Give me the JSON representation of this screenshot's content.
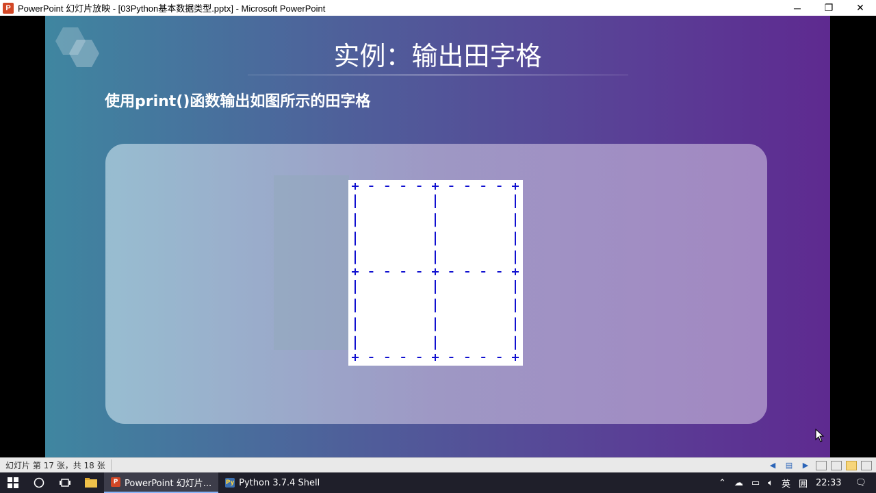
{
  "window": {
    "title": "PowerPoint 幻灯片放映 - [03Python基本数据类型.pptx] - Microsoft PowerPoint",
    "app_icon_letter": "P",
    "minimize_glyph": "─",
    "maximize_glyph": "❐",
    "close_glyph": "✕"
  },
  "slide": {
    "title": "实例：输出田字格",
    "subtitle": "使用print()函数输出如图所示的田字格",
    "grid_color": "#1010d0",
    "background_colors": [
      "#3f86a0",
      "#5e2a90"
    ]
  },
  "statusbar": {
    "slide_info": "幻灯片 第 17 张，共 18 张"
  },
  "taskbar": {
    "apps": [
      {
        "label": "PowerPoint 幻灯片...",
        "icon": "powerpoint-icon"
      },
      {
        "label": "Python 3.7.4 Shell",
        "icon": "python-icon"
      }
    ],
    "tray": {
      "ime": "英",
      "time": "22:33"
    }
  }
}
